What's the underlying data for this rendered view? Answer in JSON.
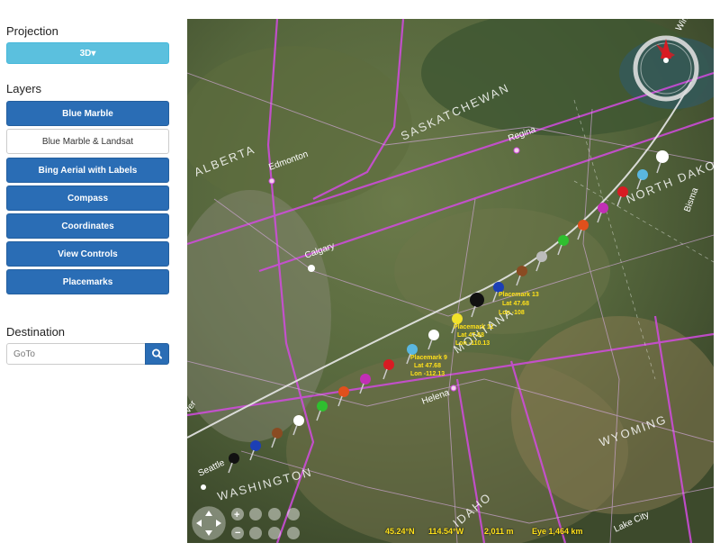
{
  "sidebar": {
    "projection": {
      "title": "Projection",
      "button_label": "3D▾"
    },
    "layers": {
      "title": "Layers",
      "items": [
        {
          "label": "Blue Marble",
          "enabled": true
        },
        {
          "label": "Blue Marble & Landsat",
          "enabled": false
        },
        {
          "label": "Bing Aerial with Labels",
          "enabled": true
        },
        {
          "label": "Compass",
          "enabled": true
        },
        {
          "label": "Coordinates",
          "enabled": true
        },
        {
          "label": "View Controls",
          "enabled": true
        },
        {
          "label": "Placemarks",
          "enabled": true
        }
      ]
    },
    "destination": {
      "title": "Destination",
      "placeholder": "GoTo",
      "search_icon": "search-icon"
    }
  },
  "map": {
    "regions": [
      "SASKATCHEWAN",
      "ALBERTA",
      "NORTH DAKOTA",
      "MONTANA",
      "WYOMING",
      "WASHINGTON",
      "IDAHO"
    ],
    "cities": [
      "Edmonton",
      "Regina",
      "Calgary",
      "Helena",
      "Seattle",
      "Bisma",
      "Lake City",
      "Winn",
      "ver"
    ],
    "placemark_labels": [
      {
        "name": "Placemark 13",
        "lat": "Lat 47.68",
        "lon": "Lon -108"
      },
      {
        "name": "Placemark 11",
        "lat": "Lat 47.68",
        "lon": "Lon -110.13"
      },
      {
        "name": "Placemark 9",
        "lat": "Lat 47.68",
        "lon": "Lon -112.13"
      }
    ],
    "status": {
      "lat": "45.24°N",
      "lon": "114.54°W",
      "altitude": "2,011 m",
      "eye": "Eye  1,464 km"
    },
    "colors": {
      "pin_label": "#ffe11a",
      "border": "#d24be0",
      "status_text": "#ffe11a"
    }
  }
}
